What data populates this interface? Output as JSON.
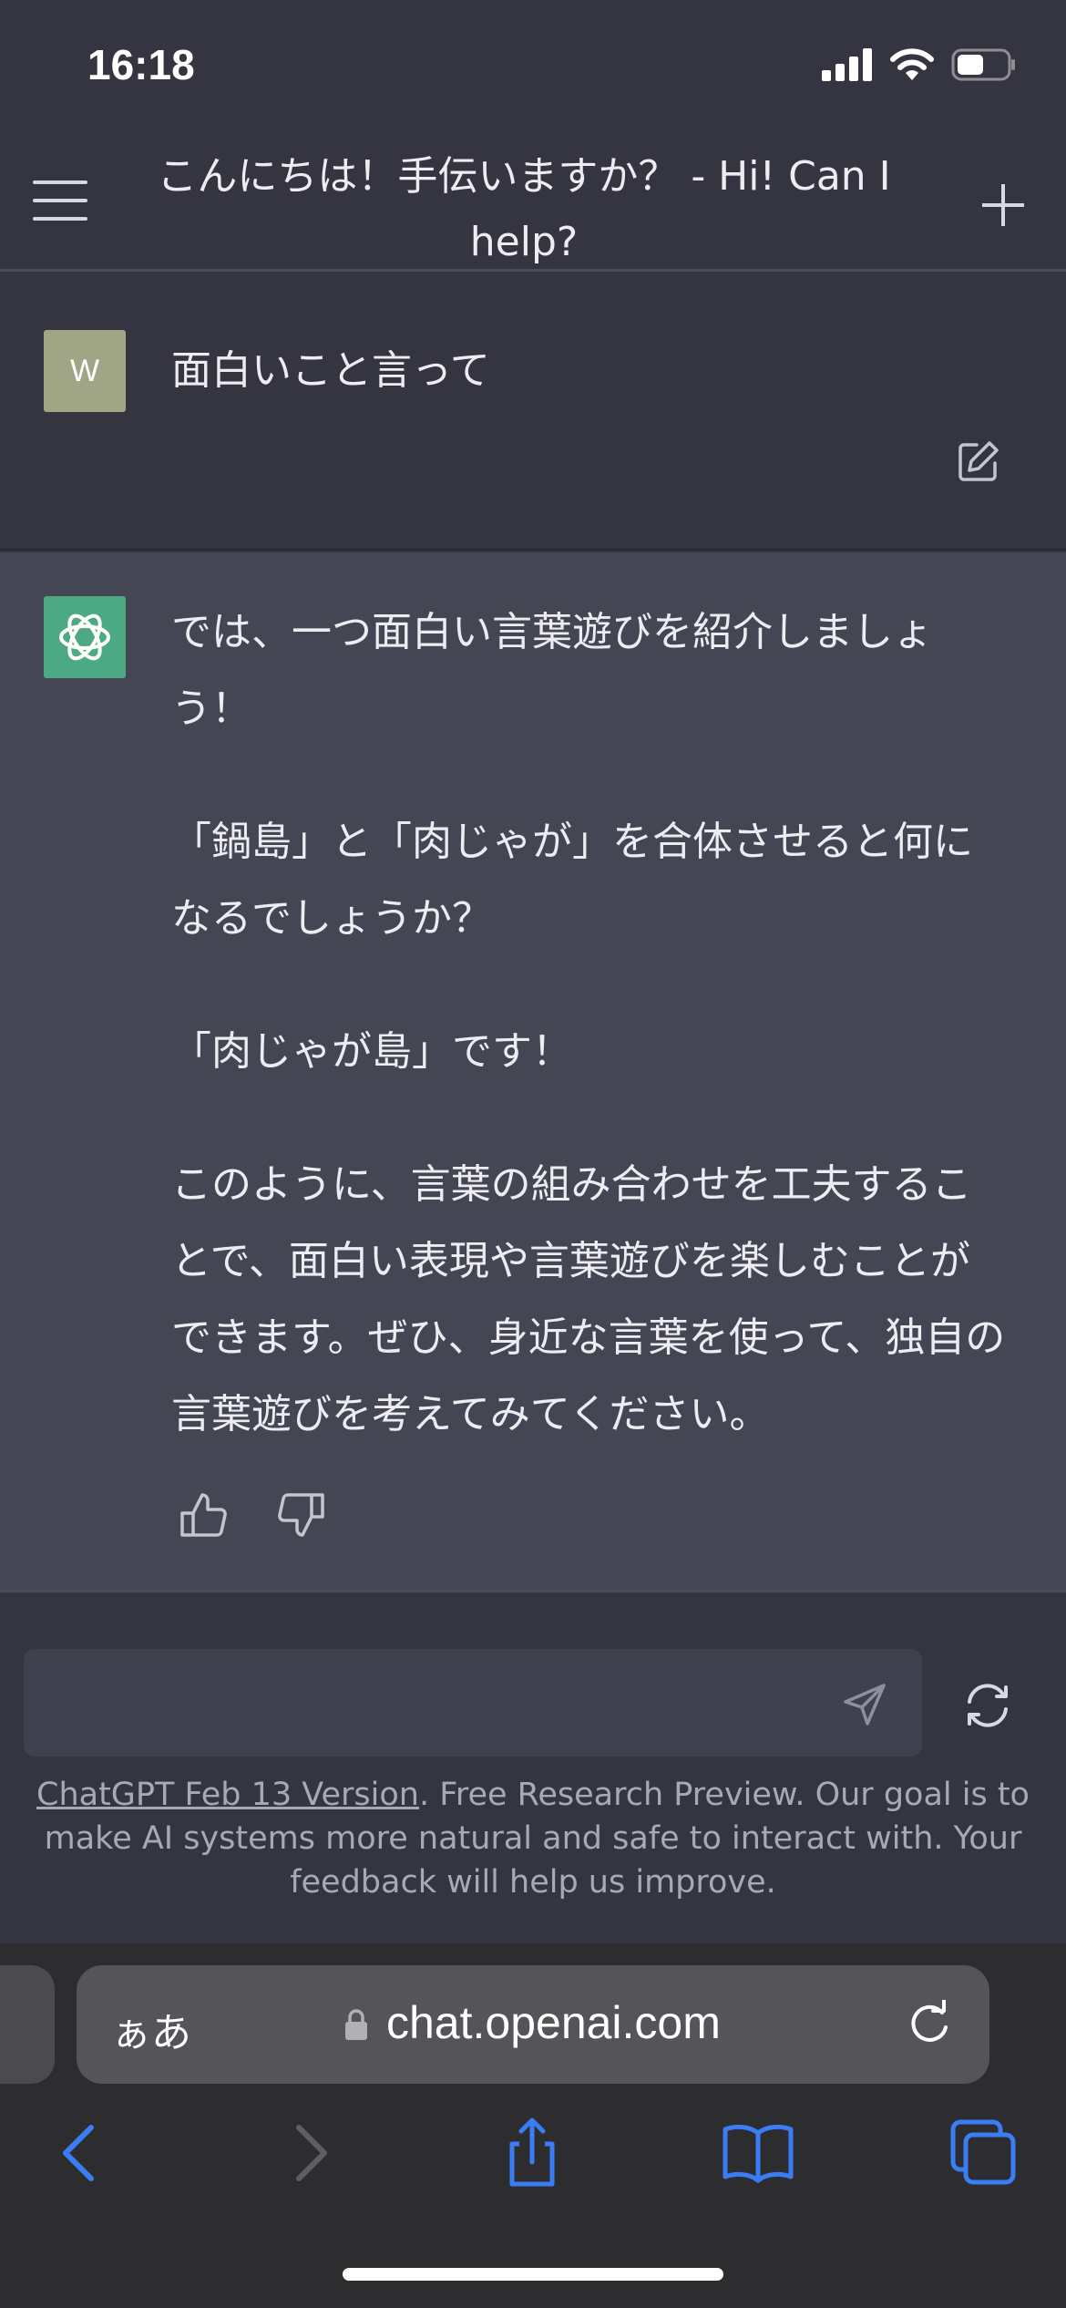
{
  "status_bar": {
    "time": "16:18"
  },
  "header": {
    "title": "こんにちは！手伝いますか？ - Hi! Can I help?",
    "menu_icon": "hamburger-icon",
    "new_chat_icon": "plus-icon"
  },
  "conversation": {
    "user": {
      "avatar_initial": "W",
      "message": "面白いこと言って"
    },
    "assistant": {
      "paragraphs": [
        "では、一つ面白い言葉遊びを紹介しましょう！",
        "「鍋島」と「肉じゃが」を合体させると何になるでしょうか？",
        "「肉じゃが島」です！",
        "このように、言葉の組み合わせを工夫することで、面白い表現や言葉遊びを楽しむことができます。ぜひ、身近な言葉を使って、独自の言葉遊びを考えてみてください。"
      ]
    }
  },
  "composer": {
    "input_value": "",
    "send_icon": "send-icon",
    "regenerate_icon": "refresh-icon"
  },
  "footer": {
    "version_link": "ChatGPT Feb 13 Version",
    "disclaimer": ". Free Research Preview. Our goal is to make AI systems more natural and safe to interact with. Your feedback will help us improve."
  },
  "browser": {
    "text_size_label": "ぁあ",
    "url": "chat.openai.com"
  },
  "colors": {
    "background": "#343541",
    "assistant_background": "#444654",
    "accent_blue": "#3a7df6",
    "bot_avatar": "#4ca983",
    "user_avatar": "#a0a586"
  }
}
